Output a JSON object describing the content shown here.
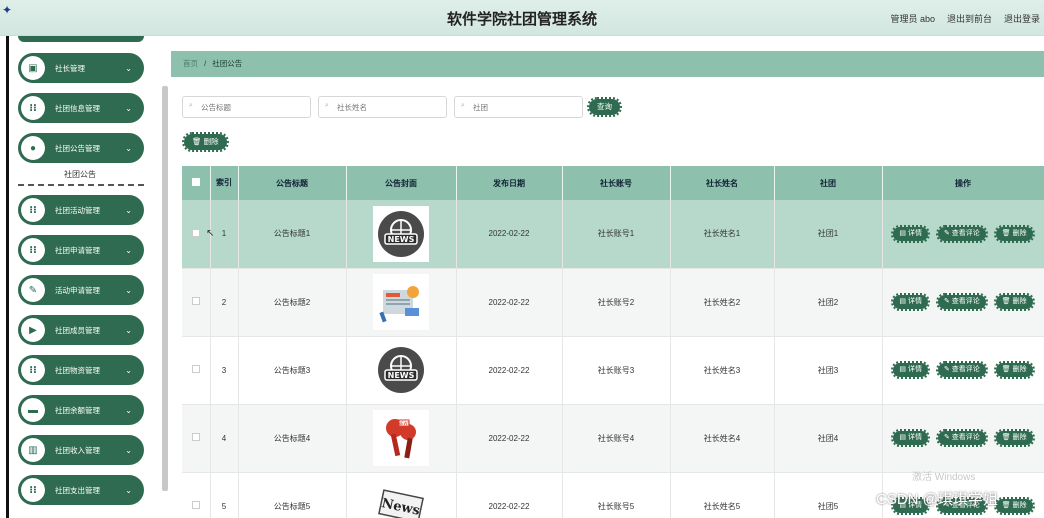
{
  "app": {
    "title": "软件学院社团管理系统",
    "logo_icon": "app-logo-icon",
    "user_label": "管理员 abo",
    "back_to_front": "退出到前台",
    "logout": "退出登录"
  },
  "sidebar": {
    "items": [
      {
        "label": "社长管理",
        "icon": "user-icon",
        "glyph": "▣"
      },
      {
        "label": "社团信息管理",
        "icon": "grid-icon",
        "glyph": "⁝⁝"
      },
      {
        "label": "社团公告管理",
        "icon": "pin-icon",
        "glyph": "●"
      },
      {
        "label": "社团活动管理",
        "icon": "grid-icon",
        "glyph": "⁝⁝"
      },
      {
        "label": "社团申请管理",
        "icon": "grid-icon",
        "glyph": "⁝⁝"
      },
      {
        "label": "活动申请管理",
        "icon": "pencil-icon",
        "glyph": "✎"
      },
      {
        "label": "社团成员管理",
        "icon": "flag-icon",
        "glyph": "▶"
      },
      {
        "label": "社团物资管理",
        "icon": "grid-icon",
        "glyph": "⁝⁝"
      },
      {
        "label": "社团余额管理",
        "icon": "wallet-icon",
        "glyph": "▬"
      },
      {
        "label": "社团收入管理",
        "icon": "chart-icon",
        "glyph": "▥"
      },
      {
        "label": "社团支出管理",
        "icon": "grid-icon",
        "glyph": "⁝⁝"
      }
    ],
    "active_sub": "社团公告"
  },
  "breadcrumb": {
    "home": "首页",
    "sep": "/",
    "current": "社团公告"
  },
  "search": {
    "title_placeholder": "公告标题",
    "name_placeholder": "社长姓名",
    "club_placeholder": "社团",
    "search_label": "查询"
  },
  "toolbar": {
    "delete_label": "删除"
  },
  "table": {
    "columns": [
      "索引",
      "公告标题",
      "公告封面",
      "发布日期",
      "社长账号",
      "社长姓名",
      "社团",
      "操作"
    ],
    "rows": [
      {
        "index": "1",
        "title": "公告标题1",
        "cover": "news-globe",
        "date": "2022-02-22",
        "account": "社长账号1",
        "name": "社长姓名1",
        "club": "社团1"
      },
      {
        "index": "2",
        "title": "公告标题2",
        "cover": "news-desk",
        "date": "2022-02-22",
        "account": "社长账号2",
        "name": "社长姓名2",
        "club": "社团2"
      },
      {
        "index": "3",
        "title": "公告标题3",
        "cover": "news-globe",
        "date": "2022-02-22",
        "account": "社长账号3",
        "name": "社长姓名3",
        "club": "社团3"
      },
      {
        "index": "4",
        "title": "公告标题4",
        "cover": "news-mic",
        "date": "2022-02-22",
        "account": "社长账号4",
        "name": "社长姓名4",
        "club": "社团4"
      },
      {
        "index": "5",
        "title": "公告标题5",
        "cover": "news-paper",
        "date": "2022-02-22",
        "account": "社长账号5",
        "name": "社长姓名5",
        "club": "社团5"
      }
    ],
    "op_detail": "详情",
    "op_comments": "查看评论",
    "op_delete": "删除"
  },
  "overlay": {
    "windows_watermark": "激活 Windows",
    "csdn_watermark": "CSDN @琪琪学姐"
  },
  "colors": {
    "accent": "#2f6b50",
    "header": "#8dc1ae",
    "row_highlight": "#b6d9cc"
  }
}
